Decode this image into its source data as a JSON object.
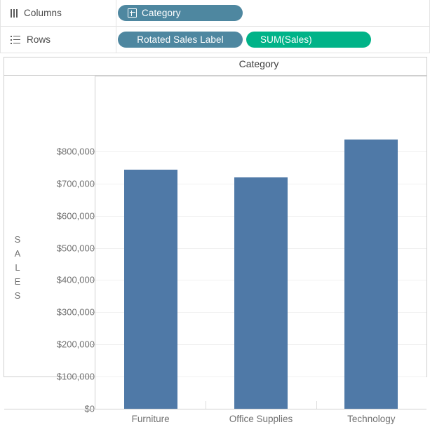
{
  "shelves": {
    "columns": {
      "label": "Columns",
      "icon": "columns-icon",
      "pills": [
        {
          "text": "Category",
          "type": "dimension",
          "icon": "hierarchy-expand-icon"
        }
      ]
    },
    "rows": {
      "label": "Rows",
      "icon": "rows-icon",
      "pills": [
        {
          "text": "Rotated Sales Label",
          "type": "dimension"
        },
        {
          "text": "SUM(Sales)",
          "type": "measure"
        }
      ]
    }
  },
  "colors": {
    "dimension_pill": "#4e87a0",
    "measure_pill": "#00b388",
    "bar": "#4f79a7",
    "gridline": "#f0f0f0",
    "frame": "#cfcfcf"
  },
  "chart_data": {
    "type": "bar",
    "title": "Category",
    "xlabel": "",
    "ylabel": "SALES",
    "ylabel_stacked": [
      "S",
      "A",
      "L",
      "E",
      "S"
    ],
    "categories": [
      "Furniture",
      "Office Supplies",
      "Technology"
    ],
    "values": [
      742000,
      719000,
      837000
    ],
    "value_labels": [
      "$742,000",
      "$719,000",
      "$837,000"
    ],
    "ylim": [
      0,
      900000
    ],
    "yticks": [
      0,
      100000,
      200000,
      300000,
      400000,
      500000,
      600000,
      700000,
      800000
    ],
    "ytick_labels": [
      "$0",
      "$100,000",
      "$200,000",
      "$300,000",
      "$400,000",
      "$500,000",
      "$600,000",
      "$700,000",
      "$800,000"
    ],
    "grid": true,
    "legend": "none",
    "series": [
      {
        "name": "SUM(Sales)",
        "values": [
          742000,
          719000,
          837000
        ]
      }
    ]
  }
}
